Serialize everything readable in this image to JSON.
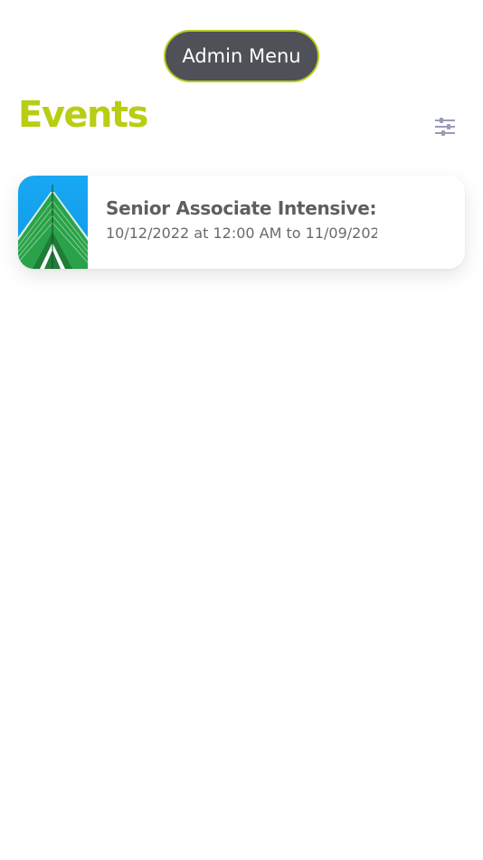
{
  "header": {
    "admin_menu_label": "Admin Menu"
  },
  "page": {
    "title": "Events",
    "filter_icon": "sliders-icon"
  },
  "colors": {
    "accent": "#b9cd12",
    "button_bg": "#4e5157"
  },
  "events": [
    {
      "title": "Senior Associate Intensive: ...",
      "date_range": "10/12/2022 at 12:00 AM to 11/09/202...",
      "thumbnail": "building-image"
    }
  ]
}
